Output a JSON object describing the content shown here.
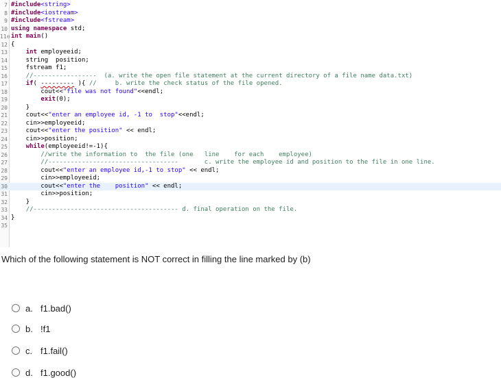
{
  "code": {
    "lines": [
      {
        "n": "7",
        "tokens": [
          {
            "c": "inc",
            "t": "#include"
          },
          {
            "c": "hdr",
            "t": "<string>"
          }
        ]
      },
      {
        "n": "8",
        "tokens": [
          {
            "c": "inc",
            "t": "#include"
          },
          {
            "c": "hdr",
            "t": "<iostream>"
          }
        ]
      },
      {
        "n": "9",
        "tokens": [
          {
            "c": "inc",
            "t": "#include"
          },
          {
            "c": "hdr",
            "t": "<fstream>"
          }
        ]
      },
      {
        "n": "10",
        "tokens": [
          {
            "c": "kw",
            "t": "using"
          },
          {
            "c": "",
            "t": " "
          },
          {
            "c": "kw",
            "t": "namespace"
          },
          {
            "c": "",
            "t": " std;"
          }
        ]
      },
      {
        "n": "11⊖",
        "tokens": [
          {
            "c": "kw",
            "t": "int"
          },
          {
            "c": "",
            "t": " "
          },
          {
            "c": "kw",
            "t": "main"
          },
          {
            "c": "",
            "t": "()"
          }
        ]
      },
      {
        "n": "12",
        "tokens": [
          {
            "c": "",
            "t": "{"
          }
        ]
      },
      {
        "n": "13",
        "tokens": [
          {
            "c": "",
            "t": "    "
          },
          {
            "c": "kw",
            "t": "int"
          },
          {
            "c": "",
            "t": " employeeid;"
          }
        ]
      },
      {
        "n": "14",
        "tokens": [
          {
            "c": "",
            "t": "    string  position;"
          }
        ]
      },
      {
        "n": "15",
        "tokens": [
          {
            "c": "",
            "t": "    fstream f1;"
          }
        ]
      },
      {
        "n": "16",
        "tokens": [
          {
            "c": "",
            "t": "    "
          },
          {
            "c": "cm",
            "t": "//-----------------  (a. write the open file statement at the current directory of a file name data.txt)"
          }
        ]
      },
      {
        "n": "17",
        "tokens": [
          {
            "c": "",
            "t": "    "
          },
          {
            "c": "kw",
            "t": "if"
          },
          {
            "c": "",
            "t": "( "
          },
          {
            "c": "err",
            "t": "---------"
          },
          {
            "c": "",
            "t": " ){ "
          },
          {
            "c": "cm",
            "t": "//     b. write the check status of the file opened."
          }
        ]
      },
      {
        "n": "18",
        "tokens": [
          {
            "c": "",
            "t": "        cout<<"
          },
          {
            "c": "str",
            "t": "\"file was not found\""
          },
          {
            "c": "",
            "t": "<<endl;"
          }
        ]
      },
      {
        "n": "19",
        "tokens": [
          {
            "c": "",
            "t": "        "
          },
          {
            "c": "kw",
            "t": "exit"
          },
          {
            "c": "",
            "t": "(0);"
          }
        ]
      },
      {
        "n": "20",
        "tokens": [
          {
            "c": "",
            "t": "    }"
          }
        ]
      },
      {
        "n": "21",
        "tokens": [
          {
            "c": "",
            "t": "    cout<<"
          },
          {
            "c": "str",
            "t": "\"enter an employee id, -1 to  stop\""
          },
          {
            "c": "",
            "t": "<<endl;"
          }
        ]
      },
      {
        "n": "22",
        "tokens": [
          {
            "c": "",
            "t": "    cin>>employeeid;"
          }
        ]
      },
      {
        "n": "23",
        "tokens": [
          {
            "c": "",
            "t": "    cout<<"
          },
          {
            "c": "str",
            "t": "\"enter the position\""
          },
          {
            "c": "",
            "t": " << endl;"
          }
        ]
      },
      {
        "n": "24",
        "tokens": [
          {
            "c": "",
            "t": "    cin>>position;"
          }
        ]
      },
      {
        "n": "25",
        "tokens": [
          {
            "c": "",
            "t": "    "
          },
          {
            "c": "kw",
            "t": "while"
          },
          {
            "c": "",
            "t": "(employeeid!=-1){"
          }
        ]
      },
      {
        "n": "26",
        "tokens": [
          {
            "c": "",
            "t": "        "
          },
          {
            "c": "cm",
            "t": "//write the information to  the file (one   line    for each    employee)"
          }
        ]
      },
      {
        "n": "27",
        "tokens": [
          {
            "c": "",
            "t": "        "
          },
          {
            "c": "cm",
            "t": "//-----------------------------------       c. write the employee id and position to the file in one line."
          }
        ]
      },
      {
        "n": "28",
        "tokens": [
          {
            "c": "",
            "t": "        cout<<"
          },
          {
            "c": "str",
            "t": "\"enter an employee id,-1 to stop\""
          },
          {
            "c": "",
            "t": " << endl;"
          }
        ]
      },
      {
        "n": "29",
        "tokens": [
          {
            "c": "",
            "t": "        cin>>employeeid;"
          }
        ]
      },
      {
        "n": "30",
        "tokens": [
          {
            "c": "",
            "t": "        cout<<"
          },
          {
            "c": "str",
            "t": "\"enter the    position\""
          },
          {
            "c": "",
            "t": " << endl;"
          }
        ]
      },
      {
        "n": "31",
        "tokens": [
          {
            "c": "",
            "t": "        cin>>position;"
          }
        ]
      },
      {
        "n": "32",
        "tokens": [
          {
            "c": "",
            "t": "    }"
          }
        ]
      },
      {
        "n": "33",
        "tokens": [
          {
            "c": "",
            "t": "    "
          },
          {
            "c": "cm",
            "t": "//--------------------------------------- d. final operation on the file."
          }
        ]
      },
      {
        "n": "34",
        "tokens": [
          {
            "c": "",
            "t": "}"
          }
        ]
      },
      {
        "n": "35",
        "tokens": []
      }
    ],
    "highlight_line": "30"
  },
  "question": "Which of the following statement is NOT correct in filling the line marked by (b)",
  "options": [
    {
      "letter": "a.",
      "text": "f1.bad()"
    },
    {
      "letter": "b.",
      "text": "!f1"
    },
    {
      "letter": "c.",
      "text": "f1.fail()"
    },
    {
      "letter": "d.",
      "text": "f1.good()"
    }
  ]
}
